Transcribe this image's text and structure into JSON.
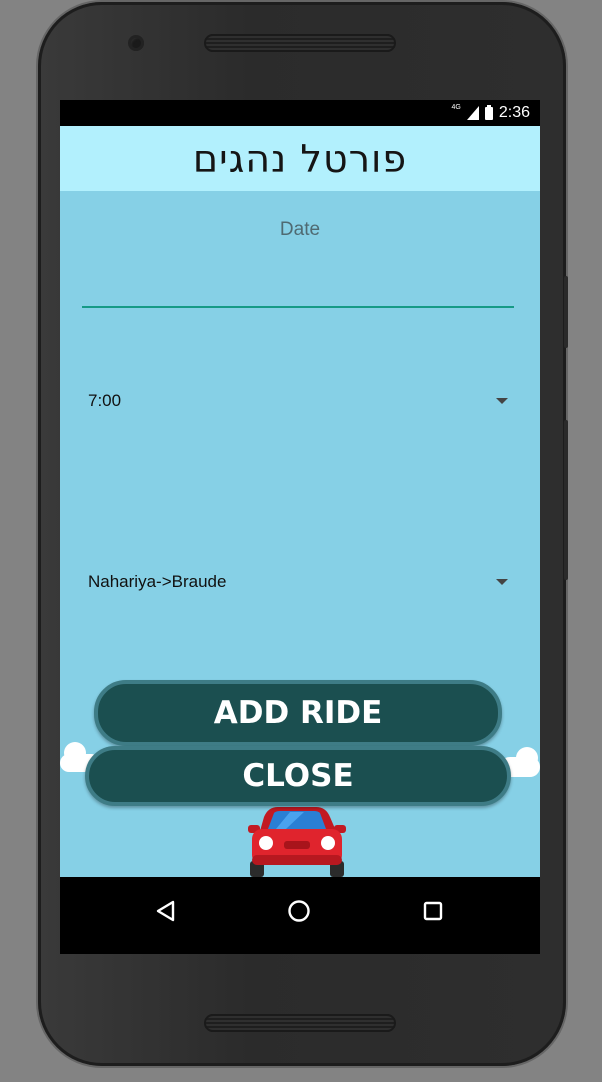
{
  "statusbar": {
    "network": "4G",
    "time": "2:36"
  },
  "app": {
    "title": "פורטל נהגים"
  },
  "form": {
    "date_placeholder": "Date",
    "time_spinner": {
      "selected": "7:00"
    },
    "route_spinner": {
      "selected": "Nahariya->Braude"
    }
  },
  "buttons": {
    "add_ride": "ADD RIDE",
    "close": "CLOSE"
  },
  "nav": {
    "back": "back-icon",
    "home": "home-icon",
    "recents": "recents-icon"
  },
  "colors": {
    "appbar": "#b2f0fd",
    "background": "#86d0e6",
    "button": "#1b4f50",
    "underline": "#169a86"
  }
}
